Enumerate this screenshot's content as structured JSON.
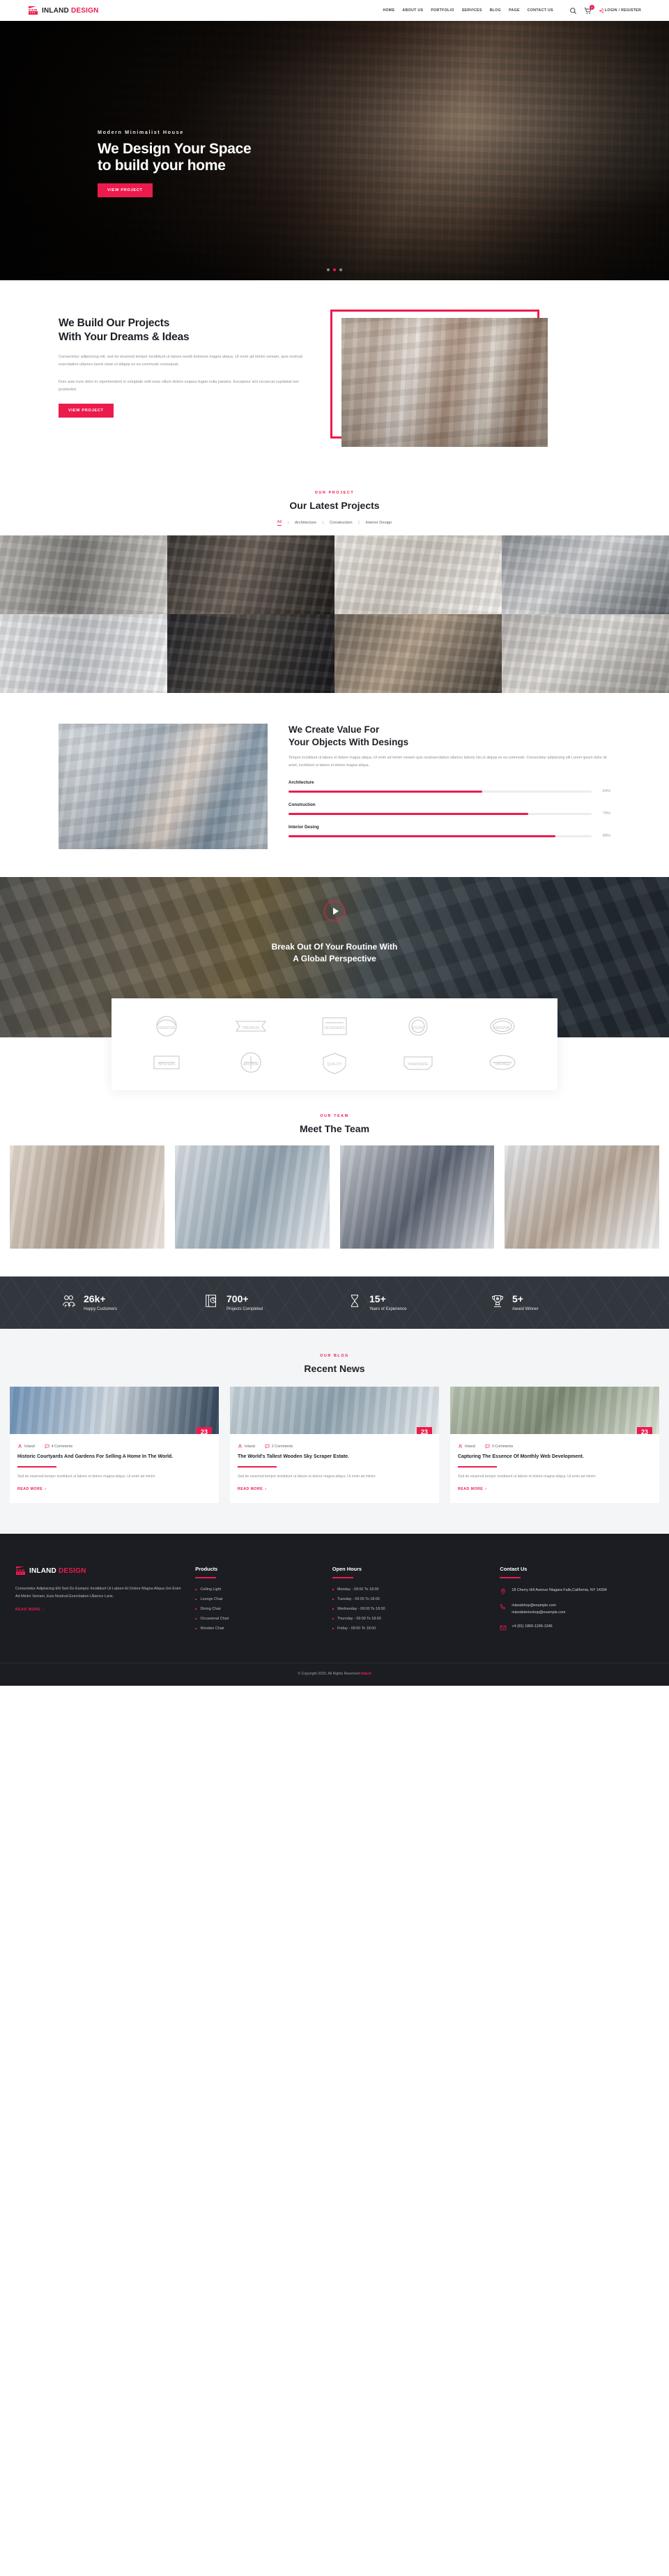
{
  "header": {
    "logo": {
      "first": "INLAND",
      "second": "DESIGN"
    },
    "nav": [
      {
        "label": "HOME"
      },
      {
        "label": "ABOUT US"
      },
      {
        "label": "PORTFOLIO"
      },
      {
        "label": "SERVICES"
      },
      {
        "label": "BLOG"
      },
      {
        "label": "PAGE"
      },
      {
        "label": "CONTACT US"
      }
    ],
    "search_icon": "search-icon",
    "cart_icon": "cart-icon",
    "cart_count": "0",
    "login_label": "LOGIN / REGISTER"
  },
  "hero": {
    "subtitle": "Modern Minimalist House",
    "title_line1": "We Design Your Space",
    "title_line2": "to build your home",
    "button": "VIEW PROJECT",
    "slides": 3,
    "active_slide": 2
  },
  "about": {
    "title_line1": "We Build Our Projects",
    "title_line2": "With Your Dreams & Ideas",
    "paragraph1": "Consectetur adipisicing elit, sed do eiusmod tempor incididunt ut labore eesdt doloesre magna aliqua. Ut enim ad minim veniam, quis nostrud exercitation ullamco laoris niseii ut aliquip ex ea commodo consequat.",
    "paragraph2": "Duis aute irure dolor in reprehenderit in voluptate velit esse cillum dolore esqasu fugiat nulla pariatur. Excepteur sint occaecat cupidatat non proidertint.",
    "button": "VIEW PROJECT"
  },
  "portfolio": {
    "eyebrow": "OUR PROJECT",
    "title": "Our Latest Projects",
    "filters": [
      {
        "label": "All",
        "active": true
      },
      {
        "label": "Architecture",
        "active": false
      },
      {
        "label": "Construction",
        "active": false
      },
      {
        "label": "Interior Design",
        "active": false
      }
    ],
    "separator": "||",
    "tiles": [
      {
        "name": "living-room-grey-sofa",
        "c1": "#b9b6b2",
        "c2": "#7d7b78",
        "c3": "#d8d5d1"
      },
      {
        "name": "dark-kitchen-island",
        "c1": "#3b3733",
        "c2": "#6d625a",
        "c3": "#1c1a18"
      },
      {
        "name": "bright-curtains-window",
        "c1": "#ece9e4",
        "c2": "#cfc9c0",
        "c3": "#f6f4f1"
      },
      {
        "name": "white-bathroom-tub",
        "c1": "#8c9095",
        "c2": "#d7d9db",
        "c3": "#5c6166"
      },
      {
        "name": "minimal-white-interior",
        "c1": "#e8e9eb",
        "c2": "#c3c6ca",
        "c3": "#f3f4f6"
      },
      {
        "name": "dark-lounge-pendant-lights",
        "c1": "#26262a",
        "c2": "#4a4641",
        "c3": "#15151a"
      },
      {
        "name": "warm-living-room-ceiling",
        "c1": "#6d6459",
        "c2": "#b3a08a",
        "c3": "#3c3731"
      },
      {
        "name": "marble-wall-stair-light",
        "c1": "#b8b5b1",
        "c2": "#e1dedb",
        "c3": "#8f8c89"
      }
    ]
  },
  "value": {
    "title_line1": "We Create Value For",
    "title_line2": "Your Objects With Desings",
    "paragraph": "Tempor incididunt ut labore et dolore magna aliqua. Ut enim ad minim veniam quis nostruercitation ullamco laboris nisi ut aliquip ex ea commodo. Consectetur adipisicing elit Lorem ipsum dolor sit amet, incididunt ut labore et dolore magna aliqua.",
    "skills": [
      {
        "label": "Architecture",
        "value": 64,
        "display": "64%"
      },
      {
        "label": "Construction",
        "value": 79,
        "display": "79%"
      },
      {
        "label": "Interior Desing",
        "value": 88,
        "display": "88%"
      }
    ]
  },
  "cta": {
    "play_icon": "play-icon",
    "title_line1": "Break Out Of Your Routine With",
    "title_line2": "A Global Perspective"
  },
  "brands": [
    {
      "name": "brand-laurel-badge",
      "label": "CREATIVE"
    },
    {
      "name": "brand-ribbon-banner",
      "label": "PREMIUM"
    },
    {
      "name": "brand-square-stamp",
      "label": "DESIGNERS"
    },
    {
      "name": "brand-circle-crest",
      "label": "STUDIO"
    },
    {
      "name": "brand-oval-emblem",
      "label": "ORIGINAL"
    },
    {
      "name": "brand-hipsters-badge",
      "label": "HIPSTERS"
    },
    {
      "name": "brand-round-seal",
      "label": "ARCHIVE"
    },
    {
      "name": "brand-shield-mark",
      "label": "QUALITY"
    },
    {
      "name": "brand-banner-flag",
      "label": "HANDMADE"
    },
    {
      "name": "brand-vintage-oval",
      "label": "VINTAGE"
    }
  ],
  "team": {
    "eyebrow": "OUR TEAM",
    "title": "Meet The Team",
    "members": [
      {
        "name": "team-member-1",
        "c1": "#e7dcd2",
        "c2": "#9c8d7e",
        "c3": "#f2ece6"
      },
      {
        "name": "team-member-2",
        "c1": "#d9dfe4",
        "c2": "#8fa0ad",
        "c3": "#eef2f5"
      },
      {
        "name": "team-member-3",
        "c1": "#c9ccd2",
        "c2": "#5a6270",
        "c3": "#e6e8ec"
      },
      {
        "name": "team-member-4",
        "c1": "#e0e4e8",
        "c2": "#b4a393",
        "c3": "#f1f3f5"
      }
    ]
  },
  "stats": [
    {
      "icon": "customers-icon",
      "number": "26k+",
      "label": "Happy Customers"
    },
    {
      "icon": "projects-icon",
      "number": "700+",
      "label": "Projects Completed"
    },
    {
      "icon": "hourglass-icon",
      "number": "15+",
      "label": "Years of Experience"
    },
    {
      "icon": "trophy-icon",
      "number": "5+",
      "label": "Award Winner"
    }
  ],
  "blog": {
    "eyebrow": "OUR BLOG",
    "title": "Recent News",
    "posts": [
      {
        "image": "house-with-pool",
        "day": "23",
        "month": "JAN",
        "author": "Inland",
        "comments": "4 Comments",
        "title": "Historic Courtyards And Gardens For Selling A Home In The World.",
        "excerpt": "Sed do eiusmod tempor incididunt ut labore et dolore magna aliqua. Ut enim ad minim",
        "read_more": "READ MORE",
        "c1": "#6f93b7",
        "c2": "#cfd8e0",
        "c3": "#2e4256"
      },
      {
        "image": "modern-wooden-house",
        "day": "23",
        "month": "JAN",
        "author": "Inland",
        "comments": "2 Comments",
        "title": "The World's Tallest Wooden Sky Scraper Estate.",
        "excerpt": "Sed do eiusmod tempor incididunt ut labore et dolore magna aliqua. Ut enim ad minim",
        "read_more": "READ MORE",
        "c1": "#c8d2d9",
        "c2": "#8fa3af",
        "c3": "#e8edf1"
      },
      {
        "image": "suburban-home-garden",
        "day": "23",
        "month": "JAN",
        "author": "Inland",
        "comments": "3 Comments",
        "title": "Capturing The Essence Of Monthly Web Development.",
        "excerpt": "Sed do eiusmod tempor incididunt ut labore et dolore magna aliqua. Ut enim ad minim",
        "read_more": "READ MORE",
        "c1": "#b8c3b0",
        "c2": "#7d8a74",
        "c3": "#dde4d8"
      }
    ]
  },
  "footer": {
    "logo": {
      "first": "INLAND",
      "second": "DESIGN"
    },
    "about": "Consectetur Adipisicing Elit Sed Do Eiumpor Incididunt Ut Labore Et Dolore Magna Aliqua Uet Enim Ad Minim Veniam, Euis Nostrud Exercitation Ullamco Laris.",
    "read_more": "READ MORE",
    "products": {
      "title": "Products",
      "items": [
        "Ceiling Light",
        "Lounge Chair",
        "Dining Chair",
        "Occasional Chair",
        "Wooden Chair"
      ]
    },
    "hours": {
      "title": "Open Hours",
      "items": [
        "Monday - 09:00 To 18:00",
        "Tuesday - 09:00 To 18:00",
        "Wednesday - 09:00 To 18:00",
        "Thursday - 09:00 To 18:00",
        "Friday - 09:00 To 18:00"
      ]
    },
    "contact": {
      "title": "Contact Us",
      "address": "18 Cherry Hill Avenue Niagara Falls,California, NY 14304",
      "email1": "inlandshop@example.com",
      "email2": "inlandeterioshop@example.com",
      "phone": "+4 (81) 1800-1245-1246"
    },
    "copyright_pre": "© Copyright 2020, All Rights Reserved ",
    "copyright_brand": "Inland"
  }
}
